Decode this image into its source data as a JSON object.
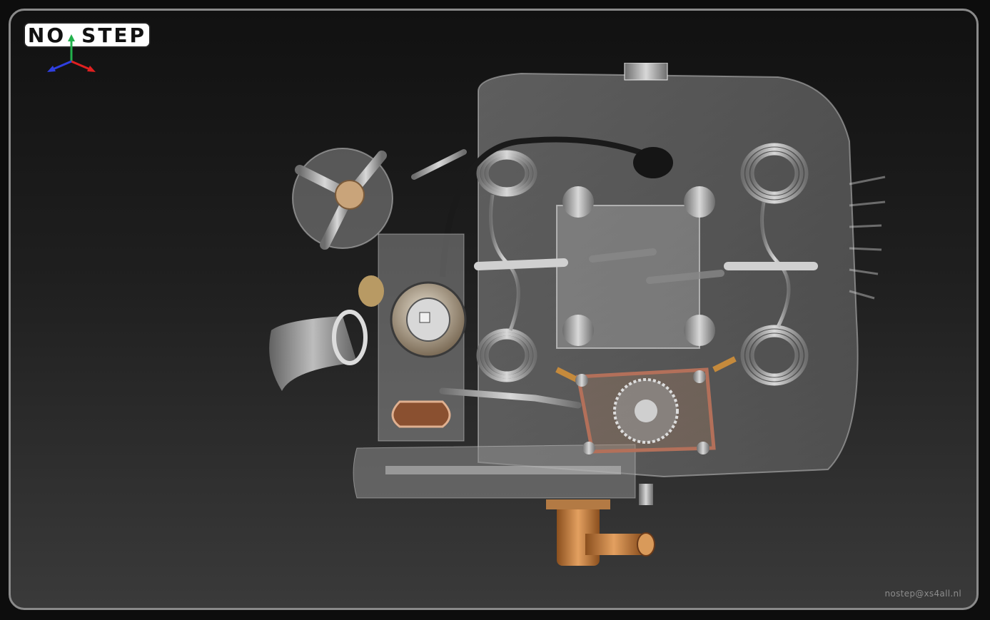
{
  "logo": {
    "left_text": "NO",
    "right_text": "STEP"
  },
  "triad": {
    "x_color": "#e02020",
    "y_color": "#22b14c",
    "z_color": "#2f3fe0"
  },
  "scene": {
    "subject": "engine-cad-model",
    "accent_copper": "#c87a3a",
    "steel": "#b8b8b8",
    "background_top": "#111111",
    "background_bottom": "#3a3a3a"
  },
  "credit": "nostep@xs4all.nl"
}
